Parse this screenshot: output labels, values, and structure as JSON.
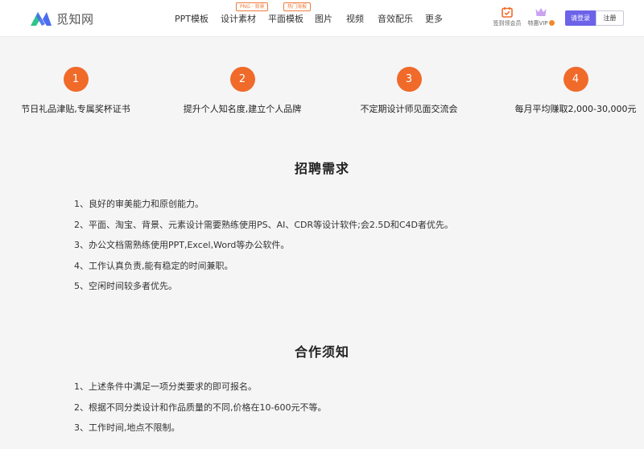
{
  "header": {
    "logo_text": "觅知网",
    "nav": [
      {
        "label": "PPT模板",
        "badge": ""
      },
      {
        "label": "设计素材",
        "badge": "PNG · 背景"
      },
      {
        "label": "平面模板",
        "badge": "热门海报"
      },
      {
        "label": "图片",
        "badge": ""
      },
      {
        "label": "视频",
        "badge": ""
      },
      {
        "label": "音效配乐",
        "badge": ""
      },
      {
        "label": "更多",
        "badge": ""
      }
    ],
    "checkin_label": "签到领会员",
    "vip_label": "特惠VIP",
    "login_label": "请登录",
    "register_label": "注册",
    "colors": {
      "brand_green": "#2fc48d",
      "brand_blue": "#4a6cf0",
      "accent_orange": "#f06a2a",
      "login_purple": "#6c63e8"
    }
  },
  "benefits": [
    {
      "number": "1",
      "text": "节日礼品津贴,专属奖杯证书"
    },
    {
      "number": "2",
      "text": "提升个人知名度,建立个人品牌"
    },
    {
      "number": "3",
      "text": "不定期设计师见面交流会"
    },
    {
      "number": "4",
      "text": "每月平均赚取2,000-30,000元"
    }
  ],
  "requirements": {
    "title": "招聘需求",
    "items": [
      "1、良好的审美能力和原创能力。",
      "2、平面、淘宝、背景、元素设计需要熟练使用PS、AI、CDR等设计软件;会2.5D和C4D者优先。",
      "3、办公文档需熟练使用PPT,Excel,Word等办公软件。",
      "4、工作认真负责,能有稳定的时间兼职。",
      "5、空闲时间较多者优先。"
    ]
  },
  "cooperation": {
    "title": "合作须知",
    "items": [
      "1、上述条件中满足一项分类要求的即可报名。",
      "2、根据不同分类设计和作品质量的不同,价格在10-600元不等。",
      "3、工作时间,地点不限制。"
    ]
  }
}
